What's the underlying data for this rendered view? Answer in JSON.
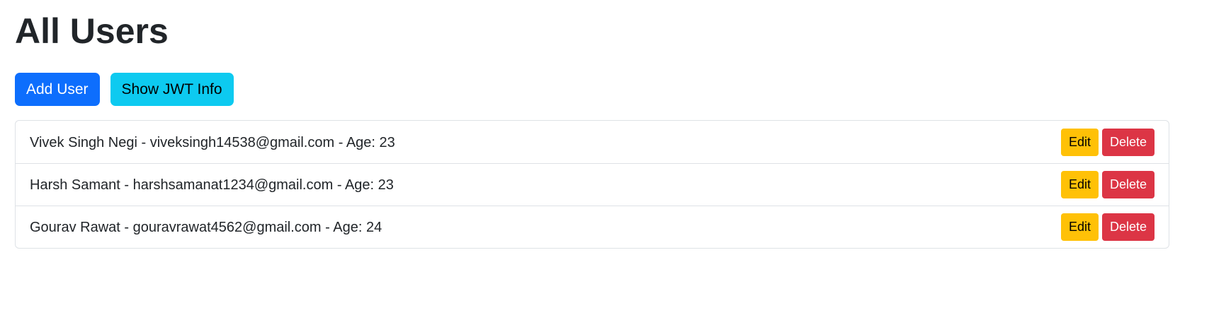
{
  "page": {
    "title": "All Users"
  },
  "toolbar": {
    "add_user_label": "Add User",
    "show_jwt_label": "Show JWT Info"
  },
  "users": [
    {
      "text": "Vivek Singh Negi - viveksingh14538@gmail.com - Age: 23",
      "edit_label": "Edit",
      "delete_label": "Delete"
    },
    {
      "text": "Harsh Samant - harshsamanat1234@gmail.com - Age: 23",
      "edit_label": "Edit",
      "delete_label": "Delete"
    },
    {
      "text": "Gourav Rawat - gouravrawat4562@gmail.com - Age: 24",
      "edit_label": "Edit",
      "delete_label": "Delete"
    }
  ],
  "colors": {
    "primary": "#0d6efd",
    "info": "#0dcaf0",
    "warning": "#ffc107",
    "danger": "#dc3545"
  }
}
